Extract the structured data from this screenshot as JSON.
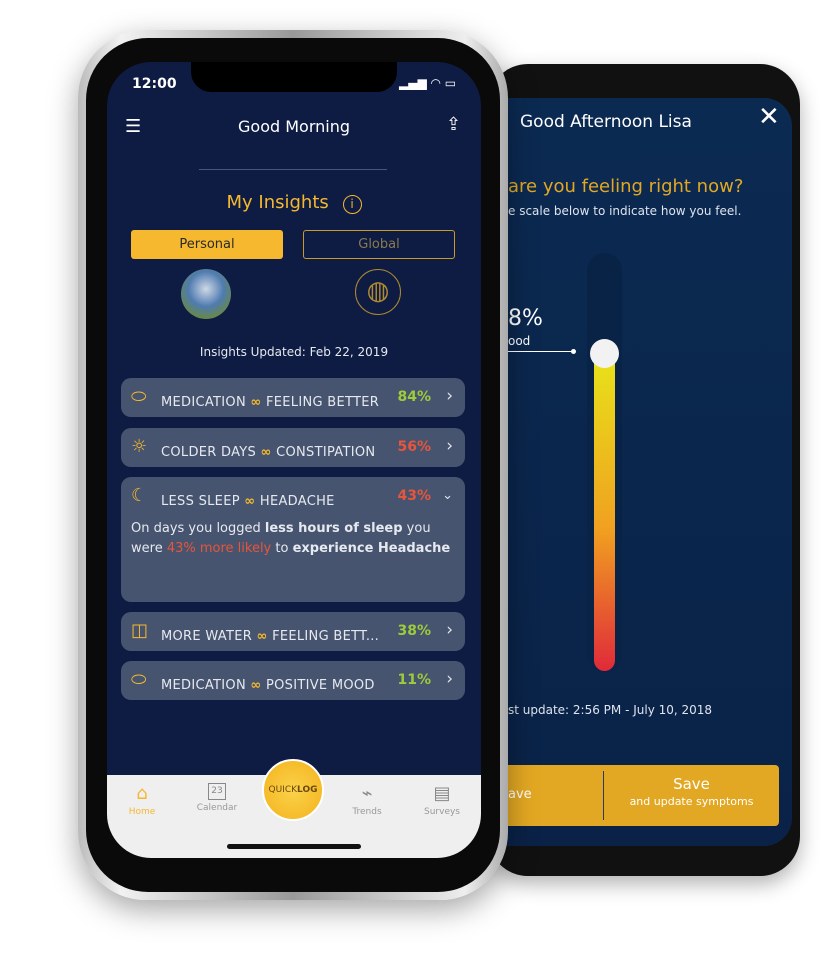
{
  "back_phone": {
    "greeting": "Good Afternoon Lisa",
    "question": "are you feeling right now?",
    "instruction": "e scale below to indicate how you feel.",
    "value": "8%",
    "value_label": "ood",
    "slider_level": 0.76,
    "last_update": "st update: 2:56 PM - July 10, 2018",
    "left_button": "ave",
    "save_button": "Save",
    "save_sub": "and update symptoms",
    "colors": {
      "accent": "#e3a823",
      "background": "#0b2a52",
      "gradient_top": "#e8e21a",
      "gradient_bottom": "#e02a3a"
    }
  },
  "front_phone": {
    "status_time": "12:00",
    "title": "Good Morning",
    "section_title": "My Insights",
    "segments": [
      "Personal",
      "Global"
    ],
    "updated": "Insights Updated: Feb 22, 2019",
    "insights": [
      {
        "icon": "pill-icon",
        "cause": "MEDICATION",
        "effect": "FEELING BETTER",
        "pct": "84%",
        "color": "#9ccc3c"
      },
      {
        "icon": "sun-icon",
        "cause": "COLDER DAYS",
        "effect": "CONSTIPATION",
        "pct": "56%",
        "color": "#e8553a"
      },
      {
        "icon": "moon-icon",
        "cause": "LESS SLEEP",
        "effect": "HEADACHE",
        "pct": "43%",
        "color": "#e8553a",
        "detail": {
          "p1": "On days you logged ",
          "b1": "less hours of sleep",
          "p2": " you were ",
          "r1": "43% more likely",
          "p3": " to ",
          "b2": "experience Headache"
        }
      },
      {
        "icon": "cup-icon",
        "cause": "MORE WATER",
        "effect": "FEELING BETT...",
        "pct": "38%",
        "color": "#9ccc3c"
      },
      {
        "icon": "pill-icon",
        "cause": "MEDICATION",
        "effect": "POSITIVE MOOD",
        "pct": "11%",
        "color": "#9ccc3c"
      }
    ],
    "tabs": [
      {
        "label": "Home",
        "icon": "home-icon"
      },
      {
        "label": "Calendar",
        "icon": "calendar-icon",
        "day": "23"
      },
      {
        "label": "Trends",
        "icon": "trends-icon"
      },
      {
        "label": "Surveys",
        "icon": "clipboard-icon"
      }
    ],
    "quicklog": {
      "a": "QUICK",
      "b": "LOG"
    },
    "colors": {
      "accent": "#f5b82e",
      "background": "#0e1c44",
      "card": "#46546f"
    }
  }
}
